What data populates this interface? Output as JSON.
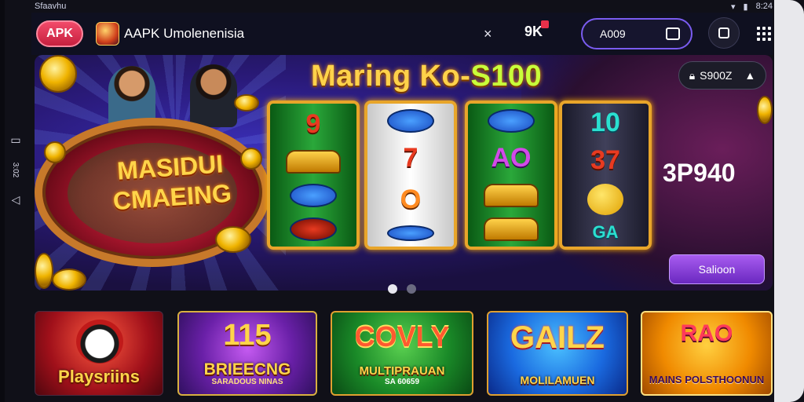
{
  "status": {
    "left": [
      "Sfaavhu"
    ],
    "right": "8:24"
  },
  "sidebar": {
    "label": "3:02"
  },
  "appbar": {
    "apk_label": "APK",
    "title": "AAPK Umolenenisia",
    "close_glyph": "×",
    "notif_label": "9K",
    "account_value": "A009"
  },
  "banner": {
    "title_main": "Maring Ko-",
    "title_accent": "S100",
    "table_text_line1": "MASIDUI",
    "table_text_line2": "CMAEING",
    "lock_label": "S900Z",
    "big_number": "3P940",
    "cta_label": "Salioon",
    "reels": [
      [
        "9",
        "",
        "",
        ""
      ],
      [
        "",
        "7",
        "O",
        ""
      ],
      [
        "",
        "AO",
        "",
        ""
      ],
      [
        "10",
        "37",
        "",
        "GA"
      ]
    ],
    "reel4_bottom": "GA"
  },
  "carousel": {
    "active_index": 0,
    "count": 2
  },
  "tiles": [
    {
      "label": "Playsriins"
    },
    {
      "big": "115",
      "label": "BRIEECNG",
      "sub": "SARADOUS NINAS"
    },
    {
      "big": "COVLY",
      "label": "MULTIPRAUAN",
      "sub": "SA 60659"
    },
    {
      "big": "GAILZ",
      "label": "MOLILAMUEN"
    },
    {
      "big": "RAO",
      "label": "MAINS POLSTHOONUN"
    }
  ],
  "colors": {
    "accent_pink": "#e8304a",
    "accent_purple": "#7a5cf0",
    "gold": "#ffd24a"
  },
  "icons": [
    "search-icon",
    "close-icon",
    "wallet-icon",
    "grid-icon",
    "lock-icon",
    "back-icon",
    "square-icon"
  ]
}
